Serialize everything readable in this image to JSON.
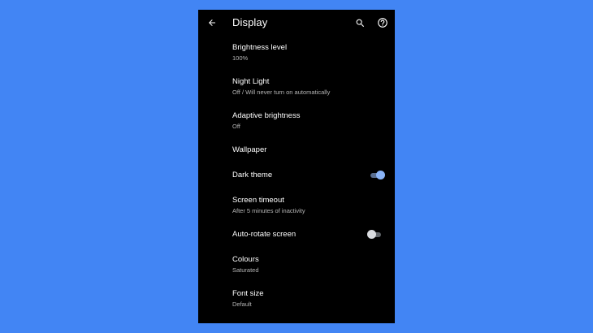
{
  "colors": {
    "background": "#4285F4",
    "screen": "#000000",
    "accent": "#8AB4F8"
  },
  "appbar": {
    "title": "Display",
    "back_icon": "arrow-back-icon",
    "search_icon": "search-icon",
    "help_icon": "help-circle-icon"
  },
  "settings": {
    "brightness": {
      "title": "Brightness level",
      "summary": "100%"
    },
    "night_light": {
      "title": "Night Light",
      "summary": "Off / Will never turn on automatically"
    },
    "adaptive_brightness": {
      "title": "Adaptive brightness",
      "summary": "Off"
    },
    "wallpaper": {
      "title": "Wallpaper"
    },
    "dark_theme": {
      "title": "Dark theme",
      "enabled": true
    },
    "screen_timeout": {
      "title": "Screen timeout",
      "summary": "After 5 minutes of inactivity"
    },
    "auto_rotate": {
      "title": "Auto-rotate screen",
      "enabled": false
    },
    "colours": {
      "title": "Colours",
      "summary": "Saturated"
    },
    "font_size": {
      "title": "Font size",
      "summary": "Default"
    }
  }
}
